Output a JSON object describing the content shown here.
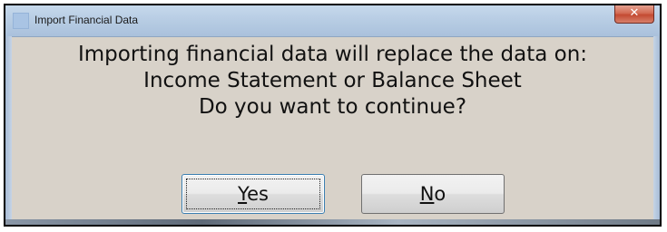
{
  "window": {
    "title": "Import Financial Data",
    "close_icon": "✕"
  },
  "message": {
    "lines": [
      "Importing financial data will replace the data on:",
      "Income Statement or Balance Sheet",
      "Do you want to continue?"
    ]
  },
  "buttons": {
    "yes": {
      "mnemonic": "Y",
      "rest": "es"
    },
    "no": {
      "mnemonic": "N",
      "rest": "o"
    }
  }
}
